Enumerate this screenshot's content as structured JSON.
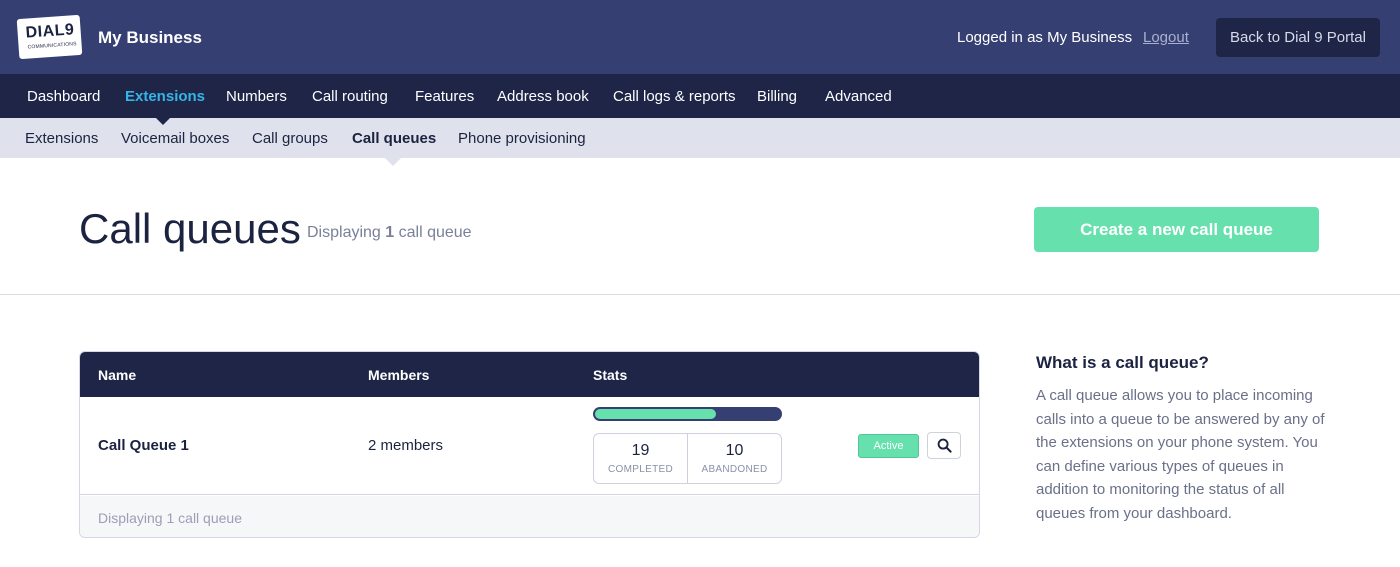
{
  "header": {
    "logo_text": "DIAL9",
    "logo_sub": "COMMUNICATIONS",
    "business_name": "My Business",
    "logged_in_text": "Logged in as My Business",
    "logout_label": "Logout",
    "portal_button_label": "Back to Dial 9 Portal"
  },
  "main_nav": {
    "items": [
      {
        "label": "Dashboard"
      },
      {
        "label": "Extensions"
      },
      {
        "label": "Numbers"
      },
      {
        "label": "Call routing"
      },
      {
        "label": "Features"
      },
      {
        "label": "Address book"
      },
      {
        "label": "Call logs & reports"
      },
      {
        "label": "Billing"
      },
      {
        "label": "Advanced"
      }
    ],
    "active": "Extensions"
  },
  "sub_nav": {
    "items": [
      {
        "label": "Extensions"
      },
      {
        "label": "Voicemail boxes"
      },
      {
        "label": "Call groups"
      },
      {
        "label": "Call queues"
      },
      {
        "label": "Phone provisioning"
      }
    ],
    "active": "Call queues"
  },
  "page": {
    "title": "Call queues",
    "count_prefix": "Displaying",
    "count_number": "1",
    "count_suffix": "call queue",
    "create_button_label": "Create a new call queue"
  },
  "table": {
    "columns": [
      "Name",
      "Members",
      "Stats"
    ],
    "rows": [
      {
        "name": "Call Queue 1",
        "members": "2 members",
        "completed": 19,
        "completed_label": "COMPLETED",
        "abandoned": 10,
        "abandoned_label": "ABANDONED",
        "completed_fraction": 0.655,
        "status": "Active"
      }
    ],
    "footer_text": "Displaying 1 call queue"
  },
  "info": {
    "title": "What is a call queue?",
    "text": "A call queue allows you to place incoming calls into a queue to be answered by any of the extensions on your phone system. You can define various types of queues in addition to monitoring the status of all queues from your dashboard."
  },
  "colors": {
    "header_bg": "#353f72",
    "nav_bg": "#1e2547",
    "subnav_bg": "#dfe1ec",
    "accent_green": "#66e0ad",
    "active_nav": "#35b4e6"
  },
  "icons": {
    "search": "search-icon"
  }
}
